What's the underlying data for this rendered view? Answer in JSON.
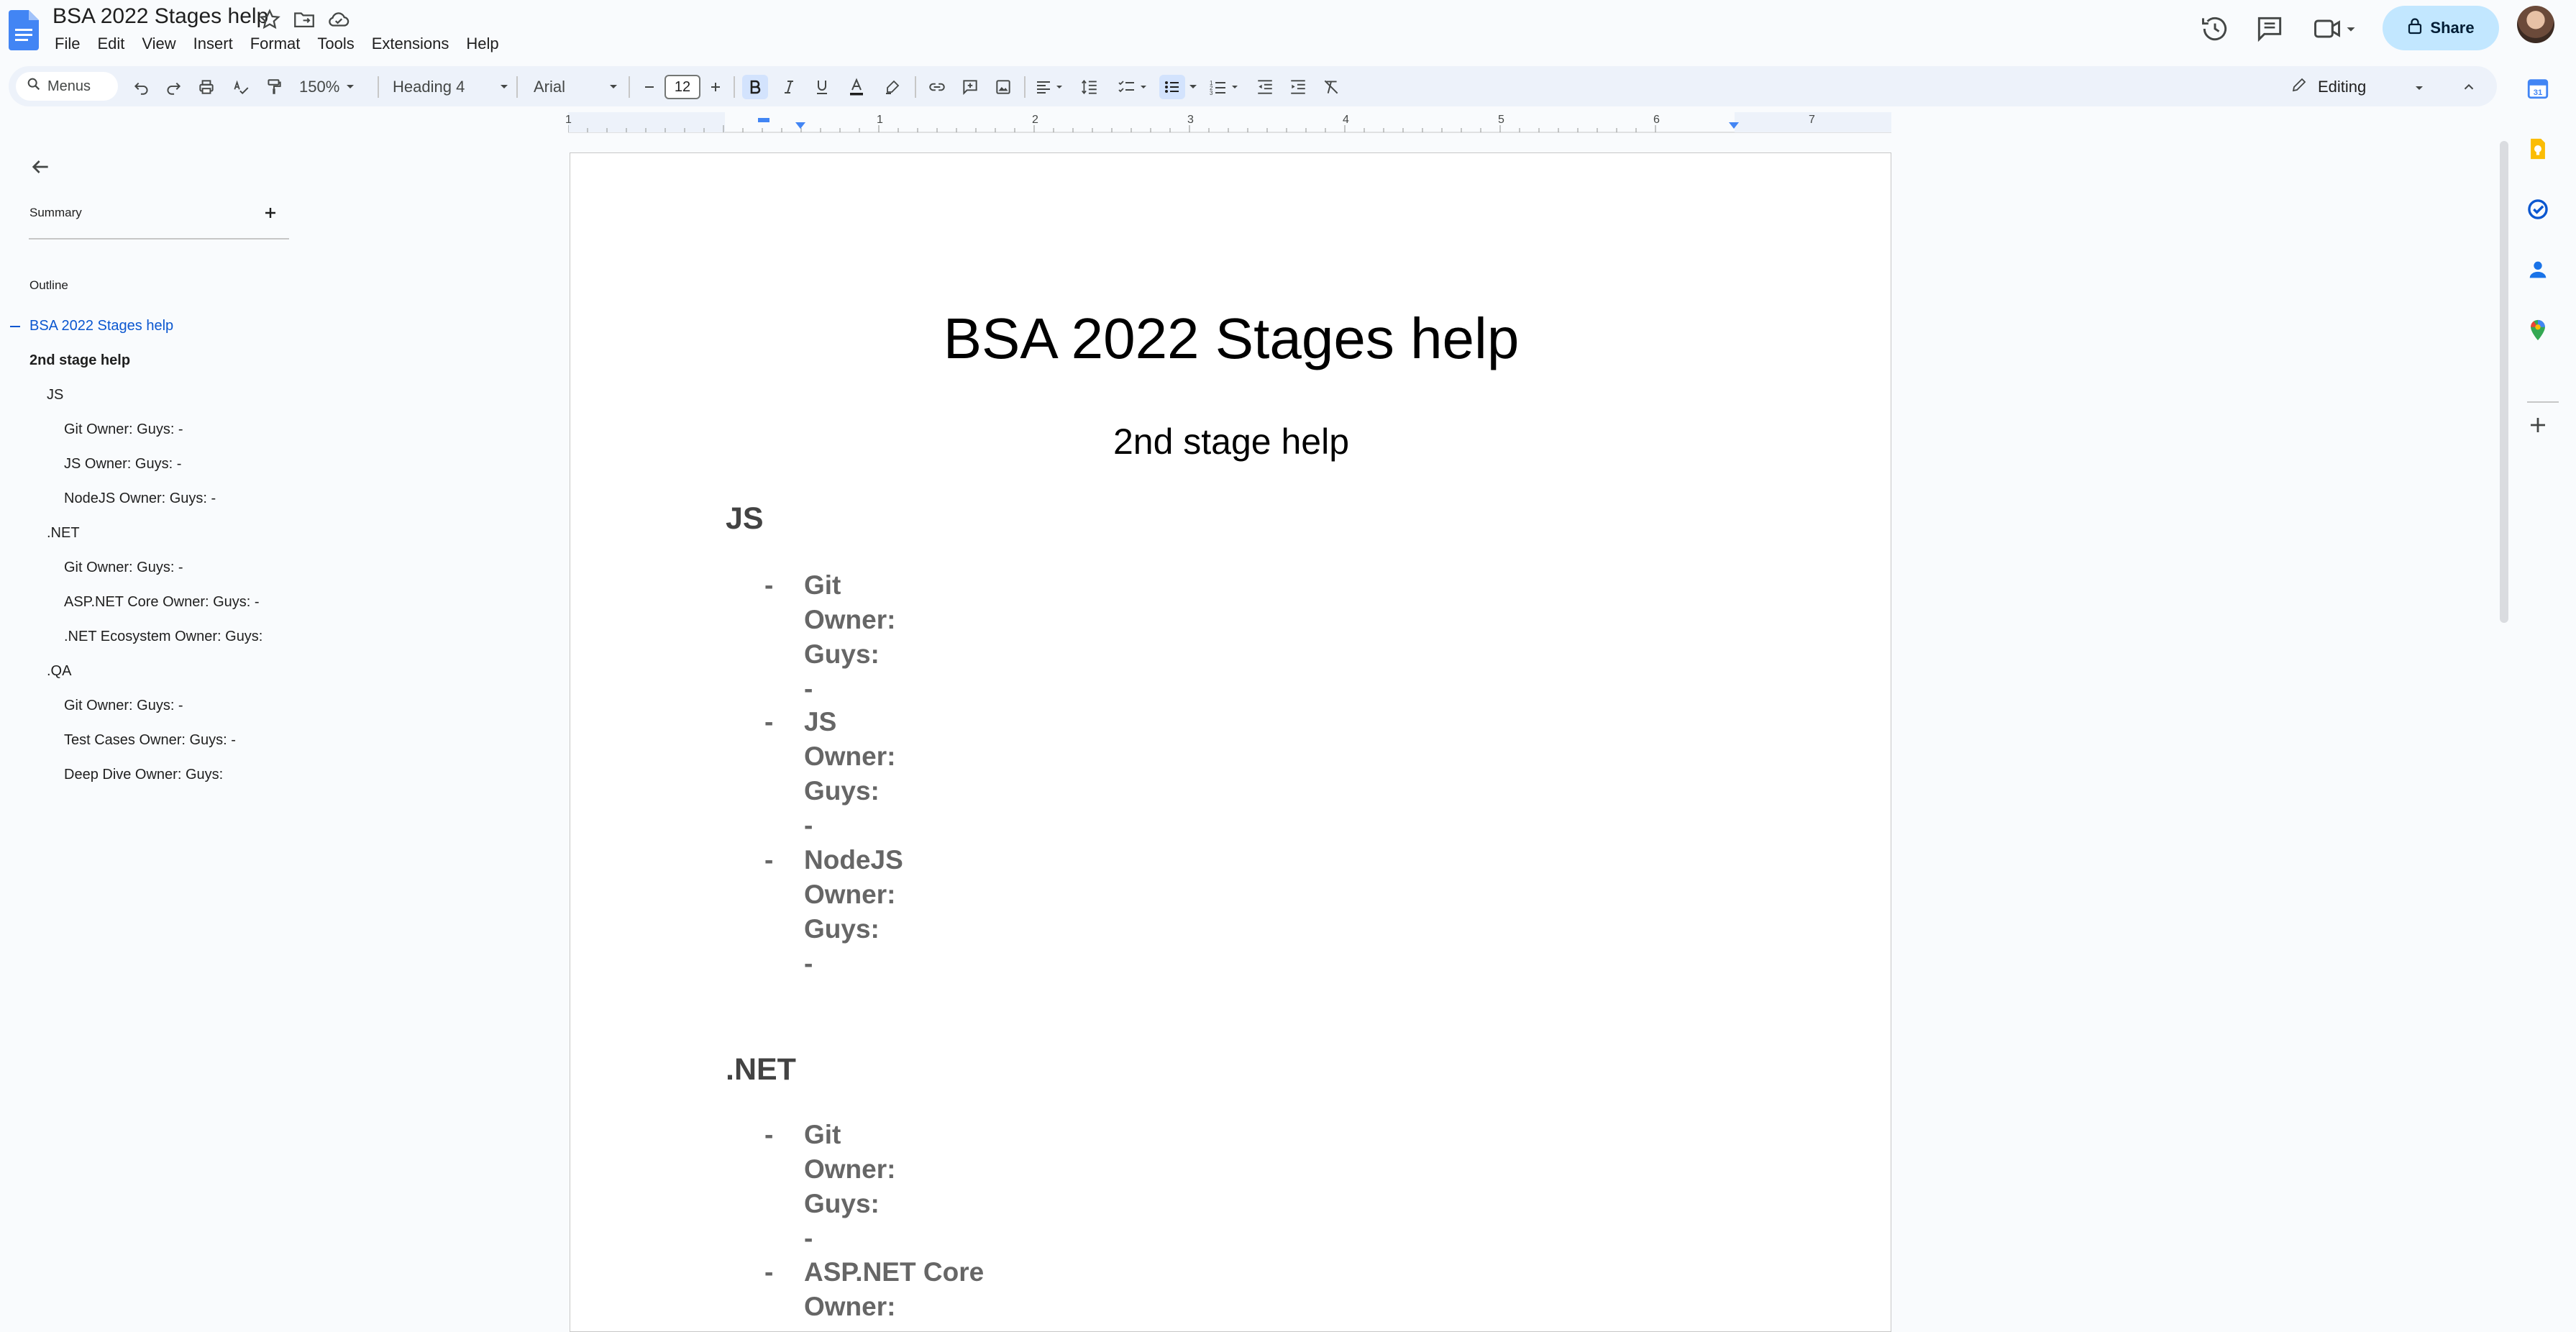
{
  "document": {
    "title": "BSA 2022 Stages help"
  },
  "menubar": [
    "File",
    "Edit",
    "View",
    "Insert",
    "Format",
    "Tools",
    "Extensions",
    "Help"
  ],
  "header": {
    "share_label": "Share"
  },
  "toolbar": {
    "menus_label": "Menus",
    "zoom": "150%",
    "style": "Heading 4",
    "font": "Arial",
    "font_size": "12",
    "mode": "Editing"
  },
  "ruler": {
    "numbers": [
      "1",
      "1",
      "2",
      "3",
      "4",
      "5",
      "6",
      "7"
    ]
  },
  "outline_panel": {
    "summary_label": "Summary",
    "outline_label": "Outline",
    "items": [
      {
        "label": "BSA 2022 Stages help",
        "level": 0,
        "active": true
      },
      {
        "label": "2nd stage help",
        "level": 1
      },
      {
        "label": "JS",
        "level": 2
      },
      {
        "label": "Git Owner: Guys: -",
        "level": 3
      },
      {
        "label": "JS Owner: Guys: -",
        "level": 3
      },
      {
        "label": "NodeJS Owner: Guys: -",
        "level": 3
      },
      {
        "label": ".NET",
        "level": 2
      },
      {
        "label": "Git Owner: Guys: -",
        "level": 3
      },
      {
        "label": "ASP.NET Core Owner: Guys: -",
        "level": 3
      },
      {
        "label": ".NET Ecosystem Owner: Guys:",
        "level": 3
      },
      {
        "label": ".QA",
        "level": 2
      },
      {
        "label": "Git Owner: Guys: -",
        "level": 3
      },
      {
        "label": "Test Cases Owner: Guys: -",
        "level": 3
      },
      {
        "label": "Deep Dive Owner: Guys:",
        "level": 3
      }
    ]
  },
  "page": {
    "title": "BSA 2022 Stages help",
    "subtitle": "2nd stage help",
    "js_heading": "JS",
    "js_items": [
      {
        "dash": "-",
        "lines": [
          "Git",
          "Owner:",
          "Guys:",
          "-"
        ]
      },
      {
        "dash": "-",
        "lines": [
          "JS",
          "Owner:",
          "Guys:",
          "-"
        ]
      },
      {
        "dash": "-",
        "lines": [
          "NodeJS",
          "Owner:",
          "Guys:",
          "-"
        ]
      }
    ],
    "net_heading": ".NET",
    "net_items": [
      {
        "dash": "-",
        "lines": [
          "Git",
          "Owner:",
          "Guys:",
          "-"
        ]
      },
      {
        "dash": "-",
        "lines": [
          "ASP.NET Core",
          "Owner:"
        ]
      }
    ]
  },
  "colors": {
    "accent": "#0b57d0",
    "share_bg": "#c2e7ff",
    "toolbar_bg": "#edf2fa",
    "doc_icon": "#4285f4"
  }
}
